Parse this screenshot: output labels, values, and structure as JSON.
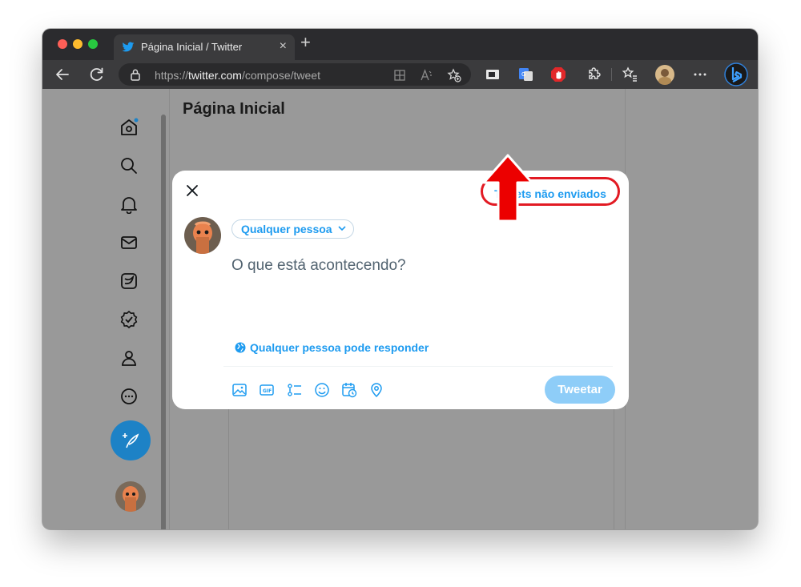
{
  "browser": {
    "tab_title": "Página Inicial / Twitter",
    "tab_close": "×",
    "new_tab": "+",
    "url_prefix": "https://",
    "url_host": "twitter.com",
    "url_path": "/compose/tweet"
  },
  "page": {
    "heading": "Página Inicial"
  },
  "sidebar": {
    "items": [
      "home-icon",
      "search-icon",
      "bell-icon",
      "mail-icon",
      "lists-icon",
      "verified-icon",
      "profile-icon",
      "more-icon"
    ]
  },
  "compose": {
    "drafts_label": "Tweets não enviados",
    "audience_label": "Qualquer pessoa",
    "placeholder": "O que está acontecendo?",
    "reply_setting": "Qualquer pessoa pode responder",
    "tweet_button": "Tweetar"
  },
  "colors": {
    "twitter_blue": "#1d9bf0",
    "annotation_red": "#e21a23"
  }
}
